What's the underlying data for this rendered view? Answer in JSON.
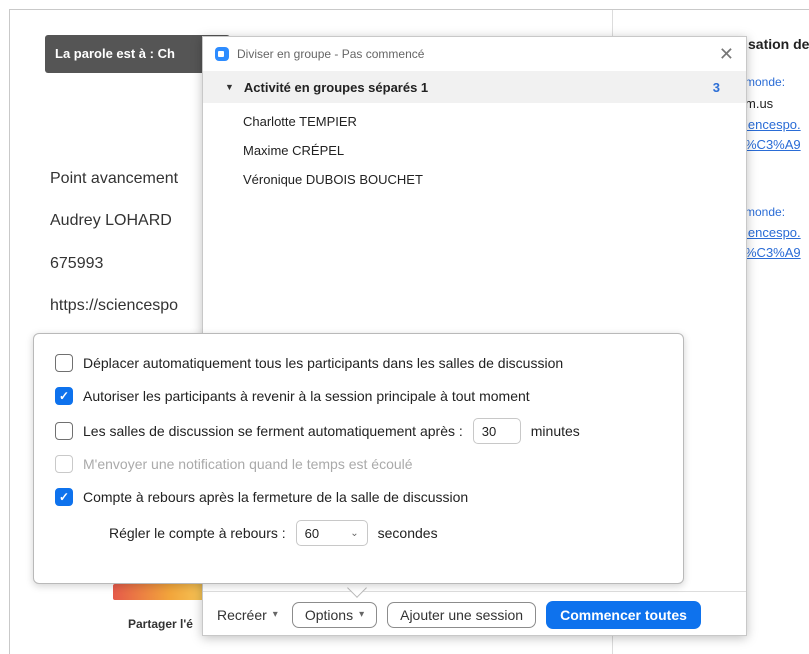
{
  "background": {
    "speaker_banner": "La parole est à : Ch",
    "doc_lines": [
      "Point avancement",
      "Audrey LOHARD",
      "675993",
      "https://sciencespo"
    ],
    "right_column": {
      "title": "sation de",
      "label1": "monde:",
      "line1": "m.us",
      "link1": "iencespo.",
      "link2": "%C3%A9",
      "label2": "monde:",
      "link3": "iencespo.",
      "link4": "%C3%A9"
    },
    "share_label": "Partager l'é"
  },
  "dialog": {
    "title": "Diviser en groupe - Pas commencé",
    "close_glyph": "✕",
    "group": {
      "name": "Activité en groupes séparés 1",
      "count": "3",
      "caret": "▼",
      "participants": [
        "Charlotte TEMPIER",
        "Maxime CRÉPEL",
        "Véronique DUBOIS BOUCHET"
      ]
    },
    "footer": {
      "recreate": "Recréer",
      "options": "Options",
      "add_session": "Ajouter une session",
      "start_all": "Commencer toutes"
    }
  },
  "options": {
    "auto_move": {
      "label": "Déplacer automatiquement tous les participants dans les salles de discussion",
      "checked": false
    },
    "allow_return": {
      "label": "Autoriser les participants à revenir à la session principale à tout moment",
      "checked": true
    },
    "auto_close": {
      "label": "Les salles de discussion se ferment automatiquement après :",
      "value": "30",
      "unit": "minutes",
      "checked": false
    },
    "notify": {
      "label": "M'envoyer une notification quand le temps est écoulé",
      "checked": false,
      "disabled": true
    },
    "countdown": {
      "label": "Compte à rebours après la fermeture de la salle de discussion",
      "checked": true
    },
    "countdown_setting": {
      "label": "Régler le compte à rebours :",
      "value": "60",
      "unit": "secondes"
    }
  },
  "colors": {
    "accent": "#0e72ed",
    "banner": "#555555",
    "link": "#2a6cd6"
  }
}
